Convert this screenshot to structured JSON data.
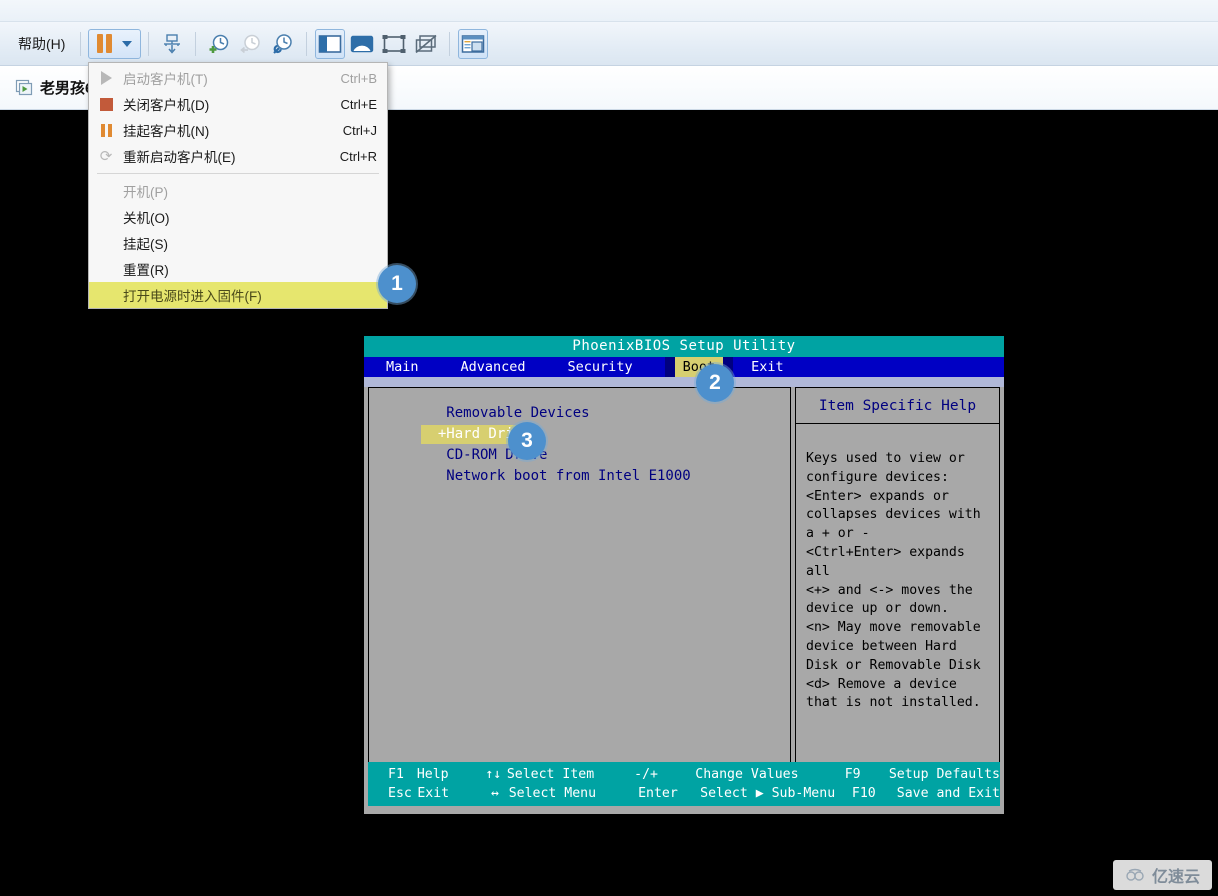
{
  "toolbar": {
    "help_menu_label": "帮助(H)",
    "buttons": [
      {
        "name": "pause-vm-button",
        "icon": "pause-icon",
        "label": "挂起"
      },
      {
        "name": "pause-dropdown-caret",
        "icon": "chevron-down-icon",
        "label": ""
      },
      {
        "name": "migrate-vm-button",
        "icon": "migrate-icon",
        "label": "迁移"
      },
      {
        "name": "take-snapshot-button",
        "icon": "clock-plus-icon",
        "label": "拍摄快照"
      },
      {
        "name": "revert-snapshot-button",
        "icon": "clock-back-icon",
        "label": "恢复快照"
      },
      {
        "name": "manage-snapshots-button",
        "icon": "clock-wrench-icon",
        "label": "管理快照"
      },
      {
        "name": "show-library-button",
        "icon": "sidebar-panel-icon",
        "label": "显示库"
      },
      {
        "name": "show-console-view-button",
        "icon": "console-view-icon",
        "label": "控制台视图"
      },
      {
        "name": "fullscreen-button",
        "icon": "fullscreen-icon",
        "label": "全屏"
      },
      {
        "name": "unity-mode-button",
        "icon": "unity-mode-icon",
        "label": "Unity 模式"
      },
      {
        "name": "preferences-button",
        "icon": "window-preferences-icon",
        "label": "首选项"
      }
    ]
  },
  "vm_tab": {
    "label": "老男孩66",
    "icon": "vm-running-icon"
  },
  "power_menu": {
    "items": [
      {
        "icon": "play-icon",
        "label": "启动客户机(T)",
        "accel": "Ctrl+B",
        "disabled": true,
        "highlighted": false,
        "indent": false
      },
      {
        "icon": "stop-icon",
        "label": "关闭客户机(D)",
        "accel": "Ctrl+E",
        "disabled": false,
        "highlighted": false,
        "indent": false
      },
      {
        "icon": "pause-icon",
        "label": "挂起客户机(N)",
        "accel": "Ctrl+J",
        "disabled": false,
        "highlighted": false,
        "indent": false
      },
      {
        "icon": "restart-icon",
        "label": "重新启动客户机(E)",
        "accel": "Ctrl+R",
        "disabled": false,
        "highlighted": false,
        "indent": false
      },
      {
        "icon": "none",
        "label": "开机(P)",
        "accel": "",
        "disabled": true,
        "highlighted": false,
        "indent": true
      },
      {
        "icon": "none",
        "label": "关机(O)",
        "accel": "",
        "disabled": false,
        "highlighted": false,
        "indent": true
      },
      {
        "icon": "none",
        "label": "挂起(S)",
        "accel": "",
        "disabled": false,
        "highlighted": false,
        "indent": true
      },
      {
        "icon": "none",
        "label": "重置(R)",
        "accel": "",
        "disabled": false,
        "highlighted": false,
        "indent": true
      },
      {
        "icon": "none",
        "label": "打开电源时进入固件(F)",
        "accel": "",
        "disabled": false,
        "highlighted": true,
        "indent": true
      }
    ],
    "separator_after_index": 3
  },
  "bios": {
    "title": "PhoenixBIOS Setup Utility",
    "tabs": [
      "Main",
      "Advanced",
      "Security",
      "Boot",
      "Exit"
    ],
    "active_tab": "Boot",
    "boot_order": [
      {
        "label": "   Removable Devices",
        "selected": false
      },
      {
        "label": "  +Hard Drive",
        "selected": true
      },
      {
        "label": "   CD-ROM Drive",
        "selected": false
      },
      {
        "label": "   Network boot from Intel E1000",
        "selected": false
      }
    ],
    "help_title": "Item Specific Help",
    "help_lines": [
      "Keys used to view or",
      "configure devices:",
      "<Enter> expands or",
      "collapses devices with",
      "a + or -",
      "<Ctrl+Enter> expands",
      "all",
      "<+> and <-> moves the",
      "device up or down.",
      "<n> May move removable",
      "device between Hard",
      "Disk or Removable Disk",
      "<d> Remove a device",
      "that is not installed."
    ],
    "footer": {
      "row1": {
        "key": "F1",
        "action": "Help",
        "arrow": "↑↓",
        "select": "Select Item",
        "key2": "-/+",
        "value2": "Change Values",
        "key3": "F9",
        "value3": "Setup Defaults"
      },
      "row2": {
        "key": "Esc",
        "action": "Exit",
        "arrow": "↔",
        "select": "Select Menu",
        "key2": "Enter",
        "value2": "Select ▶ Sub-Menu",
        "key3": "F10",
        "value3": "Save and Exit"
      }
    },
    "colors": {
      "title_bar": "#00a3a3",
      "menu_bar": "#0000c4",
      "body": "#a8a8a8",
      "highlight": "#d7cf70",
      "text_blue": "#000080"
    }
  },
  "badges": [
    {
      "name": "step-badge-1",
      "number": "1"
    },
    {
      "name": "step-badge-2",
      "number": "2"
    },
    {
      "name": "step-badge-3",
      "number": "3"
    }
  ],
  "watermark": {
    "text": "亿速云",
    "icon": "cloud-icon"
  }
}
